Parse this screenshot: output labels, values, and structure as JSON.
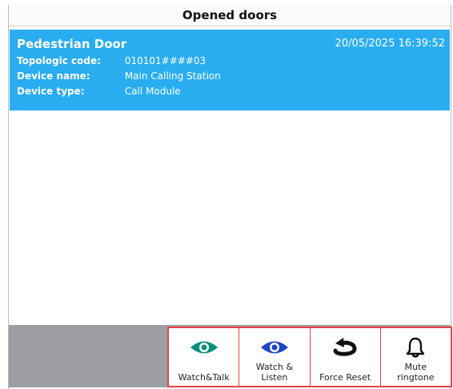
{
  "header": {
    "title": "Opened doors"
  },
  "door": {
    "name": "Pedestrian Door",
    "timestamp": "20/05/2025 16:39:52",
    "fields": [
      {
        "label": "Topologic code:",
        "value": "010101####03"
      },
      {
        "label": "Device name:",
        "value": "Main Calling Station"
      },
      {
        "label": "Device type:",
        "value": "Call Module"
      }
    ],
    "color": "#29adf0"
  },
  "actions": [
    {
      "label": "Watch&Talk",
      "icon": "eye-icon",
      "color": "#0a8f7a"
    },
    {
      "label": "Watch &\nListen",
      "icon": "eye-icon",
      "color": "#1f44c7"
    },
    {
      "label": "Force Reset",
      "icon": "reset-arrow-icon",
      "color": "#111111"
    },
    {
      "label": "Mute\nringtone",
      "icon": "bell-icon",
      "color": "#111111"
    }
  ],
  "colors": {
    "accent_border": "#e8404a",
    "bottom_bar": "#9c9ea3"
  }
}
